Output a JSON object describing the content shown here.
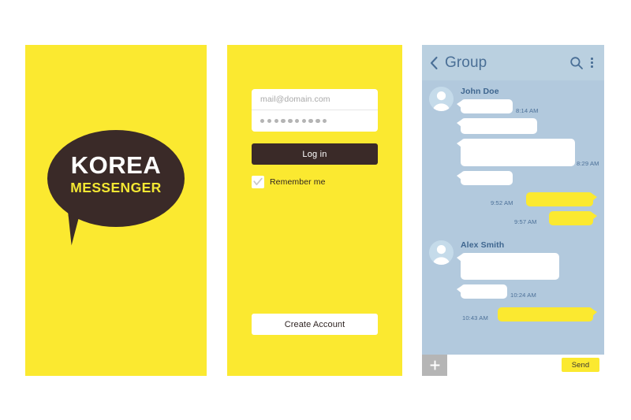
{
  "splash": {
    "logo_primary": "KOREA",
    "logo_secondary": "MESSENGER",
    "bubble_color": "#3a2a28",
    "background": "#fbe930",
    "primary_text_color": "#ffffff",
    "secondary_text_color": "#f3e733"
  },
  "login": {
    "background": "#fbe930",
    "email_placeholder": "mail@domain.com",
    "email_value": "",
    "password_mask": "••••••••••",
    "password_dot_count": 10,
    "login_label": "Log in",
    "login_button_color": "#3a2a28",
    "remember_label": "Remember me",
    "remember_checked": true,
    "create_account_label": "Create Account"
  },
  "chat": {
    "background": "#b2c9dd",
    "header": {
      "background": "#bad0e0",
      "title": "Group",
      "back_icon": "chevron-left-icon",
      "search_icon": "search-icon",
      "menu_icon": "overflow-menu-icon",
      "icon_color": "#4a6f96"
    },
    "conversations": [
      {
        "sender": "John Doe",
        "avatar": "person-avatar-icon",
        "messages": [
          {
            "direction": "incoming",
            "time": "8:14 AM",
            "text": ""
          },
          {
            "direction": "incoming",
            "time": "",
            "text": ""
          },
          {
            "direction": "incoming",
            "time": "8:29 AM",
            "text": ""
          },
          {
            "direction": "incoming",
            "time": "",
            "text": ""
          },
          {
            "direction": "outgoing",
            "time": "9:52 AM",
            "text": ""
          },
          {
            "direction": "outgoing",
            "time": "9:57 AM",
            "text": ""
          }
        ]
      },
      {
        "sender": "Alex Smith",
        "avatar": "person-avatar-icon",
        "messages": [
          {
            "direction": "incoming",
            "time": "",
            "text": ""
          },
          {
            "direction": "incoming",
            "time": "10:24 AM",
            "text": ""
          },
          {
            "direction": "outgoing",
            "time": "10:43 AM",
            "text": ""
          }
        ]
      }
    ],
    "composer": {
      "attach_icon": "plus-icon",
      "attach_button_color": "#b5b5b5",
      "input_placeholder": "",
      "input_value": "",
      "send_label": "Send",
      "send_button_color": "#fbe930"
    }
  }
}
